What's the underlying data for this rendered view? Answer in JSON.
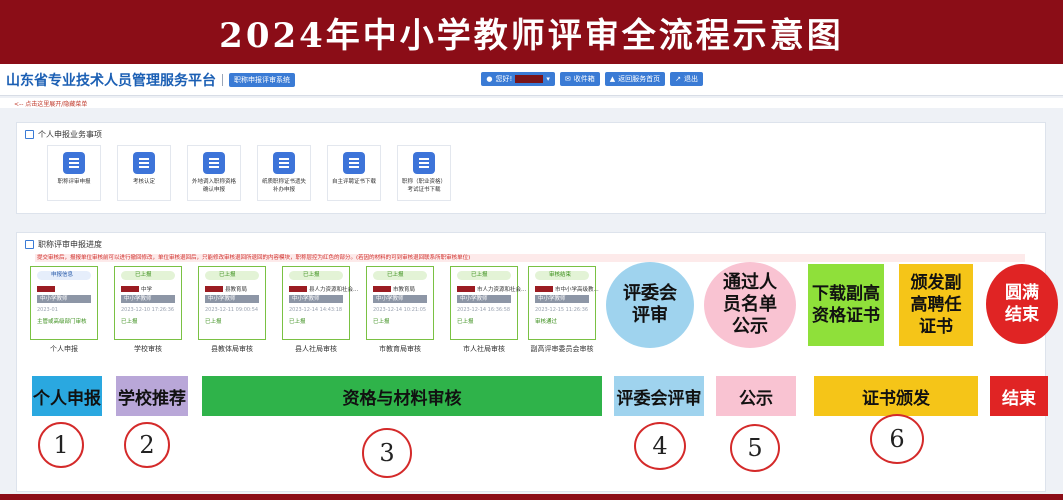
{
  "banner": {
    "title": "2024年中小学教师评审全流程示意图"
  },
  "header": {
    "platform": "山东省专业技术人员管理服务平台",
    "system_tag": "职称申报评审系统",
    "user_greeting": "您好!",
    "inbox": "收件箱",
    "back_home": "返回服务首页",
    "logout": "退出"
  },
  "subbar": {
    "hint": "<-- 点击这里展开/隐藏菜单"
  },
  "services": {
    "title": "个人申报业务事项",
    "items": [
      {
        "label": "职称评审申报"
      },
      {
        "label": "考核认定"
      },
      {
        "label": "外地调入职称资格确认申报"
      },
      {
        "label": "纸质职称证书遗失补办申报"
      },
      {
        "label": "自主评聘证书下载"
      },
      {
        "label": "职称（职业资格）考试证书下载"
      }
    ]
  },
  "progress": {
    "title": "职称评审申报进度",
    "notice": "提交审核后，报报单位审核前可以进行撤回修改，单位审核退回后，只能修改审核退回所退回的内容模块，职称层控为红色的部分。(若因的材料的可到审核退回联系所职审核单位)",
    "cards": [
      {
        "badge": "申报信息",
        "unit": "",
        "role": "中小学教师",
        "time": "2023-01",
        "status": "主管或高级部门审核",
        "label": "个人申报"
      },
      {
        "badge": "已上报",
        "unit": "中学",
        "role": "中小学教师",
        "time": "2023-12-10 17:26:36",
        "status": "已上报",
        "label": "学校审核"
      },
      {
        "badge": "已上报",
        "unit": "县教育局",
        "role": "中小学教师",
        "time": "2023-12-11 09:00:54",
        "status": "已上报",
        "label": "县教体局审核"
      },
      {
        "badge": "已上报",
        "unit": "县人力资源和社会...",
        "role": "中小学教师",
        "time": "2023-12-14 14:43:18",
        "status": "已上报",
        "label": "县人社局审核"
      },
      {
        "badge": "已上报",
        "unit": "市教育局",
        "role": "中小学教师",
        "time": "2023-12-14 10:21:05",
        "status": "已上报",
        "label": "市教育局审核"
      },
      {
        "badge": "已上报",
        "unit": "市人力资源和社会...",
        "role": "中小学教师",
        "time": "2023-12-14 16:36:58",
        "status": "已上报",
        "label": "市人社局审核"
      },
      {
        "badge": "审核结束",
        "unit": "市中小学高级教...",
        "role": "中小学教师",
        "time": "2023-12-15 11:26:36",
        "status": "审核通过",
        "label": "副高评审委员会审核"
      }
    ]
  },
  "flow": {
    "review_board": "评委会评审",
    "publicity": "通过人员名单公示",
    "download_cert": "下载副高资格证书",
    "issue_cert": "颁发副高聘任证书",
    "finish": "圆满结束"
  },
  "stages": [
    {
      "label": "个人申报",
      "num": "1",
      "color": "#2aa8e0"
    },
    {
      "label": "学校推荐",
      "num": "2",
      "color": "#b9a7d8"
    },
    {
      "label": "资格与材料审核",
      "num": "3",
      "color": "#2fb34a"
    },
    {
      "label": "评委会评审",
      "num": "4",
      "color": "#9fd3ee"
    },
    {
      "label": "公示",
      "num": "5",
      "color": "#f9c3d2"
    },
    {
      "label": "证书颁发",
      "num": "6",
      "color": "#f5c518"
    },
    {
      "label": "结束",
      "num": "",
      "color": "#e02424"
    }
  ]
}
